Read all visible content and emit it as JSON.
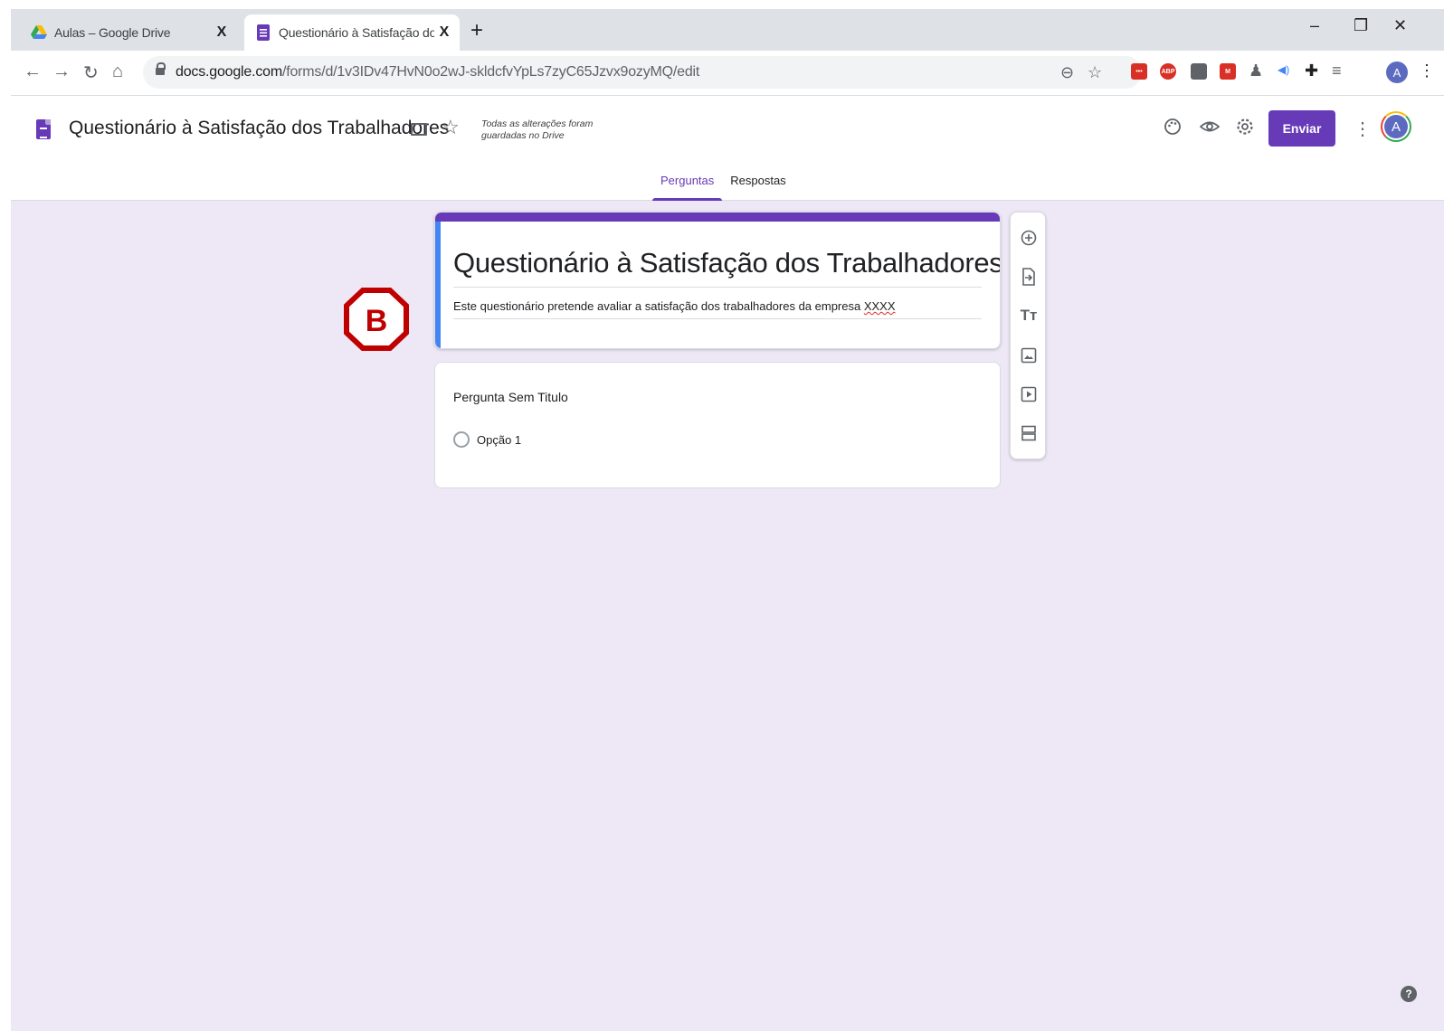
{
  "browser": {
    "tabs": [
      {
        "title": "Aulas – Google Drive",
        "icon": "google-drive-icon",
        "active": false
      },
      {
        "title": "Questionário à Satisfação dos Tra",
        "icon": "google-forms-icon",
        "active": true
      }
    ],
    "close_glyph": "X",
    "new_tab_glyph": "+",
    "url_host": "docs.google.com",
    "url_path": "/forms/d/1v3IDv47HvN0o2wJ-skldcfvYpLs7zyC65Jzvx9ozyMQ/edit",
    "profile_initial": "A",
    "extensions": [
      {
        "name": "extension-red-icon",
        "color": "#d93025",
        "label": "•••"
      },
      {
        "name": "adblock-plus-icon",
        "color": "#d93025",
        "label": "ABP"
      },
      {
        "name": "google-drive-ext-icon",
        "color": "#5f6368",
        "label": ""
      },
      {
        "name": "extension-m-icon",
        "color": "#d93025",
        "label": "M"
      }
    ]
  },
  "forms": {
    "doc_title": "Questionário à Satisfação dos Trabalhadores",
    "save_status": "Todas as alterações foram guardadas no Drive",
    "send_label": "Enviar",
    "avatar_initial": "A",
    "tabs": [
      {
        "label": "Perguntas",
        "active": true
      },
      {
        "label": "Respostas",
        "active": false
      }
    ],
    "accent_color": "#673ab7"
  },
  "form": {
    "title": "Questionário à Satisfação dos Trabalhadores",
    "description_prefix": "Este questionário pretende avaliar a satisfação dos trabalhadores da empresa ",
    "description_flagged": "XXXX",
    "question": {
      "title": "Pergunta Sem Titulo",
      "option": "Opção 1"
    }
  },
  "annotation_badge": "B",
  "side_tools": [
    "add-question-icon",
    "import-questions-icon",
    "add-title-icon",
    "add-image-icon",
    "add-video-icon",
    "add-section-icon"
  ],
  "help_glyph": "?"
}
